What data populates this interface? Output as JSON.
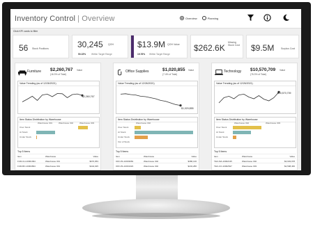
{
  "header": {
    "title": "Inventory Control",
    "separator": "|",
    "subtitle": "Overview",
    "views": [
      {
        "label": "Overview",
        "selected": true
      },
      {
        "label": "Planning",
        "selected": false
      }
    ],
    "icons": [
      "filter-icon",
      "info-icon",
      "moon-icon"
    ]
  },
  "kpi_hint": "Click KPI cards to filter",
  "kpis": {
    "stock_positions": {
      "value": "56",
      "label": "Stock Positions"
    },
    "qoh": {
      "value": "30,245",
      "label": "QOH",
      "pct": "50.15%",
      "pct_label": "Within Target Range"
    },
    "qoh_value": {
      "value": "$13.9M",
      "label": "QOH Value",
      "pct": "19.76%",
      "pct_label": "Within Target Range",
      "accent": "#4b2b6b"
    },
    "missing_stock": {
      "value": "$262.6K",
      "label": "Missing Stock Cost"
    },
    "surplus": {
      "value": "$9.5M",
      "label": "Surplus Cost"
    }
  },
  "panels": [
    {
      "name": "Furniture",
      "value": "$2,260,767",
      "value_label": "Value",
      "pct": "(16.3% of Total)",
      "trend_title": "Value Trending (as of 12/26/2021)",
      "last_value": "$2,260,767",
      "trend": [
        0.35,
        0.48,
        0.62,
        0.42,
        0.68,
        0.72,
        0.6,
        0.75,
        0.74,
        0.55,
        0.7,
        0.73,
        0.66
      ],
      "dist_title": "Item Status Distribution by Warehouse",
      "warehouses": [
        "Warehouse 001",
        "Warehouse 002",
        "Warehouse 003"
      ],
      "statuses": [
        "Over Stock",
        "At Stock",
        "Under Stock"
      ],
      "bars": [
        [
          {
            "wh": 2,
            "v": 0.5,
            "c": "#e3c04a"
          }
        ],
        [
          {
            "wh": 0,
            "v": 0.95,
            "c": "#7fb5b5"
          }
        ],
        [
          {
            "wh": 0,
            "v": 0.05,
            "c": "#e3a04a"
          }
        ]
      ],
      "items_title": "Top 5 Items",
      "columns": [
        "Item",
        "Warehouse",
        "Value"
      ],
      "rows": [
        [
          "FUR-CH-10001094",
          "Warehouse 001",
          "$670,953"
        ],
        [
          "FUR-BO-10004834",
          "Warehouse 001",
          "$444,025"
        ]
      ]
    },
    {
      "name": "Office Supplies",
      "value": "$1,020,855",
      "value_label": "Value",
      "pct": "(7.4% of Total)",
      "trend_title": "Value Trending (as of 12/26/2021)",
      "last_value": "$1,020,855",
      "trend": [
        0.72,
        0.74,
        0.7,
        0.68,
        0.62,
        0.6,
        0.55,
        0.5,
        0.42,
        0.38,
        0.3,
        0.22,
        0.18
      ],
      "dist_title": "Item Status Distribution by Warehouse",
      "warehouses": [
        "Warehouse 002"
      ],
      "statuses": [
        "Over Stock",
        "At Stock",
        "Under Stock",
        "Out of Stock"
      ],
      "bars": [
        [
          {
            "wh": 0,
            "v": 0.1,
            "c": "#e3c04a"
          }
        ],
        [
          {
            "wh": 0,
            "v": 0.95,
            "c": "#7fb5b5"
          }
        ],
        [
          {
            "wh": 0,
            "v": 0.22,
            "c": "#e3a04a"
          }
        ],
        []
      ],
      "items_title": "Top 5 Items",
      "columns": [
        "Item",
        "Warehouse",
        "Value"
      ],
      "rows": [
        [
          "OFF-PA-10003069",
          "Warehouse 002",
          "$386,136"
        ],
        [
          "OFF-PA-10001323",
          "Warehouse 002",
          "$234,286"
        ]
      ]
    },
    {
      "name": "Technology",
      "value": "$10,570,709",
      "value_label": "Value",
      "pct": "(76.3% of Total)",
      "trend_title": "Value Trending (as of 12/26/2021)",
      "last_value": "$10,570,709",
      "trend": [
        0.3,
        0.55,
        0.62,
        0.5,
        0.68,
        0.72,
        0.58,
        0.5,
        0.65,
        0.48,
        0.4,
        0.55,
        0.82
      ],
      "dist_title": "Item Status Distribution by Warehouse",
      "warehouses": [
        "Warehouse 002",
        "Warehouse 003"
      ],
      "statuses": [
        "Over Stock",
        "At Stock",
        "Under Stock"
      ],
      "bars": [
        [
          {
            "wh": 0,
            "v": 0.95,
            "c": "#e3c04a"
          }
        ],
        [
          {
            "wh": 0,
            "v": 0.6,
            "c": "#7fb5b5"
          }
        ],
        [
          {
            "wh": 0,
            "v": 0.12,
            "c": "#e3a04a"
          }
        ]
      ],
      "items_title": "Top 5 Items",
      "columns": [
        "Item",
        "Warehouse",
        "Value"
      ],
      "rows": [
        [
          "TEC-MA-10002135",
          "Warehouse 002",
          "$3,903,978"
        ],
        [
          "TEC-CO-10002527",
          "Warehouse 003",
          "$2,598,466"
        ]
      ]
    }
  ]
}
